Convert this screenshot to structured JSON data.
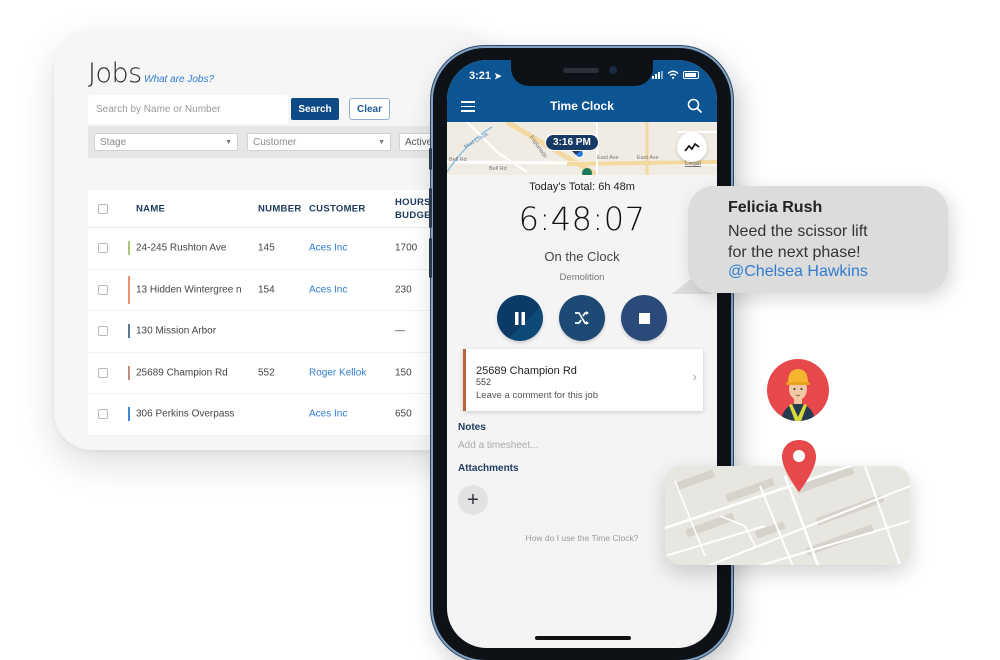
{
  "jobs_page": {
    "title": "Jobs",
    "help_link": "What are Jobs?",
    "search": {
      "placeholder": "Search by Name or Number",
      "value": ""
    },
    "search_button": "Search",
    "clear_button": "Clear",
    "filters": {
      "stage": "Stage",
      "customer": "Customer",
      "active": "Active"
    },
    "table": {
      "columns": [
        "NAME",
        "NUMBER",
        "CUSTOMER",
        "HOURS",
        "BUDGET"
      ],
      "rows": [
        {
          "name": "24-245 Rushton Ave",
          "number": "145",
          "customer": "Aces Inc",
          "hours_budget": "1700",
          "color": "#a9c97a"
        },
        {
          "name": "13 Hidden Wintergree n",
          "number": "154",
          "customer": "Aces Inc",
          "hours_budget": "230",
          "color": "#f08c70"
        },
        {
          "name": "130 Mission Arbor",
          "number": "",
          "customer": "",
          "hours_budget": "—",
          "color": "#5a7894"
        },
        {
          "name": "25689 Champion Rd",
          "number": "552",
          "customer": "Roger Kellok",
          "hours_budget": "150",
          "color": "#c48c7c"
        },
        {
          "name": "306 Perkins Overpass",
          "number": "",
          "customer": "Aces Inc",
          "hours_budget": "650",
          "color": "#3f8ad8"
        }
      ]
    }
  },
  "phone": {
    "status_time": "3:21",
    "app_title": "Time Clock",
    "map": {
      "time_pill": "3:16 PM",
      "labels": [
        "Mud Creek",
        "Bell Rd",
        "Bell Rd",
        "Esplanade",
        "East Ave",
        "East Ave",
        "Legal"
      ]
    },
    "todays_total": "Today's Total: 6h 48m",
    "timer": "6:48:07",
    "status": "On the Clock",
    "phase": "Demolition",
    "job_card": {
      "name": "25689 Champion Rd",
      "number": "552",
      "comment": "Leave a comment for this job"
    },
    "notes_label": "Notes",
    "notes_placeholder": "Add a timesheet...",
    "attachments_label": "Attachments",
    "help_link": "How do I use the Time Clock?"
  },
  "chat": {
    "sender": "Felicia Rush",
    "message_line1": "Need the scissor lift",
    "message_line2": "for the next phase!",
    "mention": "@Chelsea Hawkins"
  },
  "colors": {
    "brand_blue": "#0d5493",
    "accent_red": "#e6484b",
    "link_blue": "#2f7bd0"
  }
}
